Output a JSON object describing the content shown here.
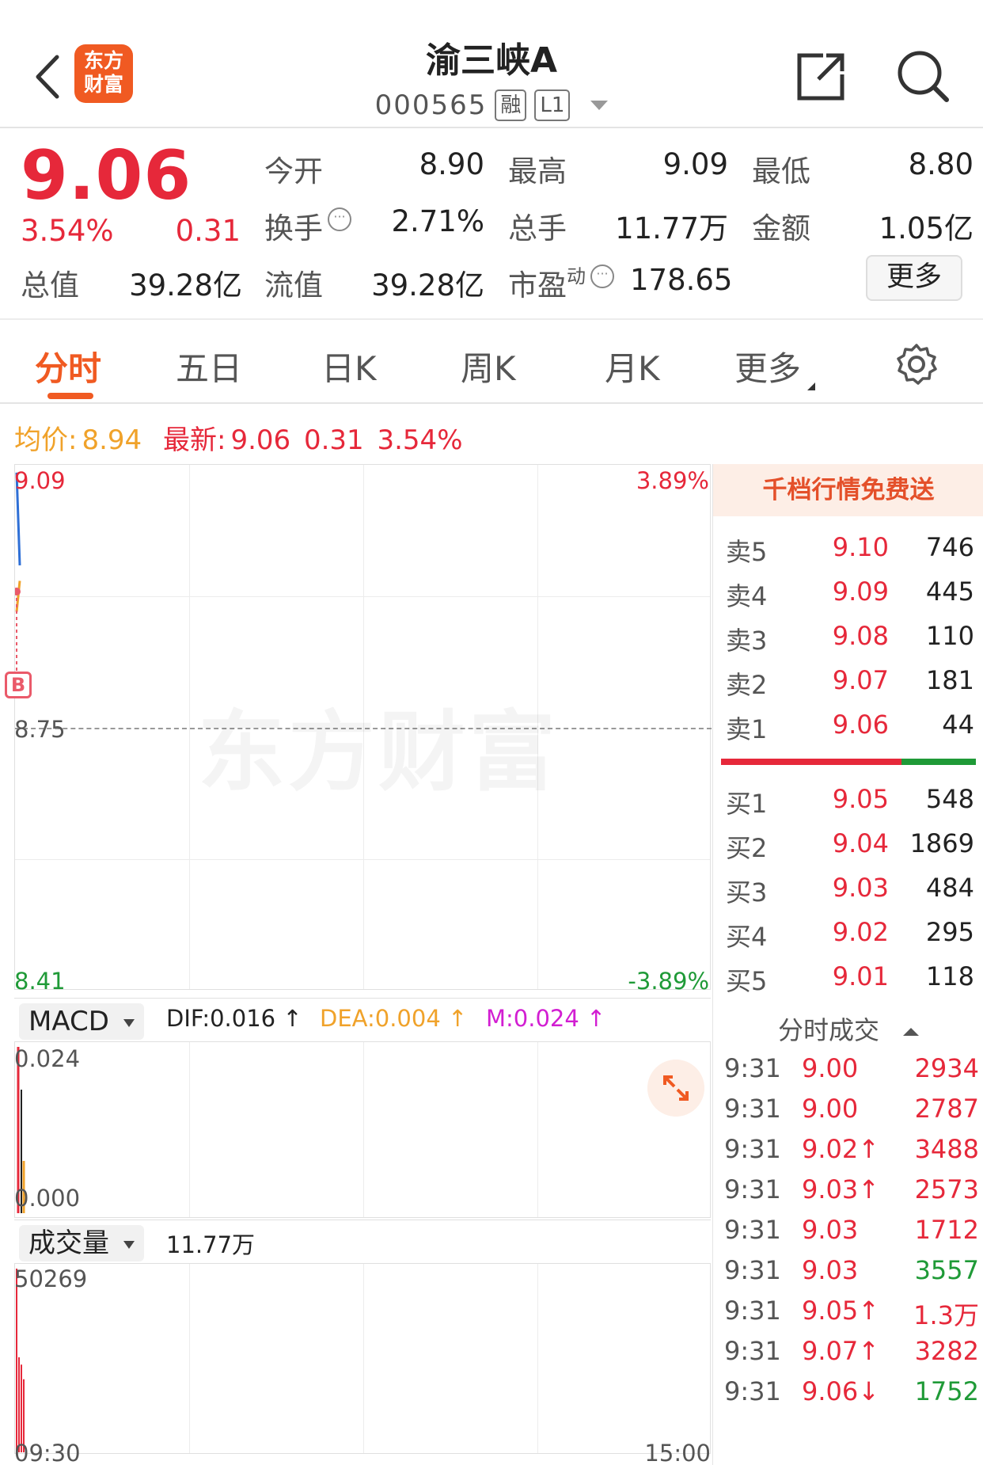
{
  "header": {
    "title": "渝三峡A",
    "code": "000565",
    "tag_rong": "融",
    "tag_l1": "L1",
    "logo_line1": "东方",
    "logo_line2": "财富"
  },
  "quote": {
    "last_price": "9.06",
    "change_pct": "3.54%",
    "change_abs": "0.31",
    "labels": {
      "open": "今开",
      "high": "最高",
      "low": "最低",
      "turnover": "换手",
      "volume": "总手",
      "amount": "金额",
      "total_value": "总值",
      "float_value": "流值",
      "pe": "市盈",
      "pe_sup": "动"
    },
    "values": {
      "open": "8.90",
      "high": "9.09",
      "low": "8.80",
      "turnover": "2.71%",
      "volume": "11.77万",
      "amount": "1.05亿",
      "total_value": "39.28亿",
      "float_value": "39.28亿",
      "pe": "178.65"
    },
    "more_label": "更多"
  },
  "tabs": [
    {
      "label": "分时",
      "active": true
    },
    {
      "label": "五日"
    },
    {
      "label": "日K"
    },
    {
      "label": "周K"
    },
    {
      "label": "月K"
    },
    {
      "label": "更多"
    }
  ],
  "info_line": {
    "avg_label": "均价:",
    "avg_value": "8.94",
    "latest_label": "最新:",
    "latest_value": "9.06",
    "latest_change": "0.31",
    "latest_pct": "3.54%"
  },
  "chart": {
    "y_top": "9.09",
    "y_mid": "8.75",
    "y_bottom": "8.41",
    "pct_top": "3.89%",
    "pct_bottom": "-3.89%",
    "watermark": "东方财富",
    "badge": "B",
    "x_start": "09:30",
    "x_end": "15:00"
  },
  "chart_data": {
    "type": "line",
    "x": [
      "09:30",
      "09:31"
    ],
    "ylim": [
      8.41,
      9.09
    ],
    "series": [
      {
        "values": [
          9.08,
          8.96
        ],
        "color": "#2e6fd6"
      },
      {
        "values": [
          8.9,
          8.94
        ],
        "color": "#f0a22a"
      }
    ],
    "volume": {
      "ylim": [
        0,
        50269
      ],
      "values": [
        50269,
        26000,
        24000,
        20000
      ]
    },
    "macd": {
      "ylim": [
        0.0,
        0.024
      ]
    }
  },
  "macd": {
    "selector": "MACD",
    "dif": "DIF:0.016 ↑",
    "dea": "DEA:0.004 ↑",
    "m": "M:0.024 ↑",
    "y_top": "0.024",
    "y_bottom": "0.000"
  },
  "volume": {
    "selector": "成交量",
    "value": "11.77万",
    "y_top": "50269"
  },
  "orderbook": {
    "promo": "千档行情免费送",
    "asks": [
      {
        "label": "卖5",
        "price": "9.10",
        "qty": "746"
      },
      {
        "label": "卖4",
        "price": "9.09",
        "qty": "445"
      },
      {
        "label": "卖3",
        "price": "9.08",
        "qty": "110"
      },
      {
        "label": "卖2",
        "price": "9.07",
        "qty": "181"
      },
      {
        "label": "卖1",
        "price": "9.06",
        "qty": "44"
      }
    ],
    "bids": [
      {
        "label": "买1",
        "price": "9.05",
        "qty": "548"
      },
      {
        "label": "买2",
        "price": "9.04",
        "qty": "1869"
      },
      {
        "label": "买3",
        "price": "9.03",
        "qty": "484"
      },
      {
        "label": "买4",
        "price": "9.02",
        "qty": "295"
      },
      {
        "label": "买5",
        "price": "9.01",
        "qty": "118"
      }
    ]
  },
  "ticks": {
    "title": "分时成交",
    "rows": [
      {
        "time": "9:31",
        "price": "9.00",
        "vol": "2934",
        "color": "red"
      },
      {
        "time": "9:31",
        "price": "9.00",
        "vol": "2787",
        "color": "red"
      },
      {
        "time": "9:31",
        "price": "9.02↑",
        "vol": "3488",
        "color": "red"
      },
      {
        "time": "9:31",
        "price": "9.03↑",
        "vol": "2573",
        "color": "red"
      },
      {
        "time": "9:31",
        "price": "9.03",
        "vol": "1712",
        "color": "red"
      },
      {
        "time": "9:31",
        "price": "9.03",
        "vol": "3557",
        "color": "green"
      },
      {
        "time": "9:31",
        "price": "9.05↑",
        "vol": "1.3万",
        "color": "red"
      },
      {
        "time": "9:31",
        "price": "9.07↑",
        "vol": "3282",
        "color": "red"
      },
      {
        "time": "9:31",
        "price": "9.06↓",
        "vol": "1752",
        "color": "green"
      }
    ]
  },
  "colors": {
    "accent": "#f05a22",
    "up": "#e6283a",
    "down": "#1f9a37",
    "avg": "#f0a22a",
    "price_line": "#2e6fd6"
  }
}
